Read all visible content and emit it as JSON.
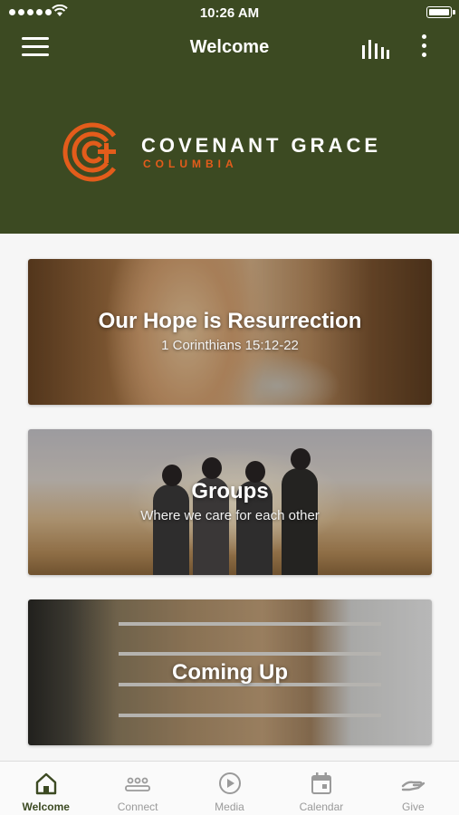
{
  "status_bar": {
    "time": "10:26 AM"
  },
  "nav": {
    "title": "Welcome"
  },
  "logo": {
    "name": "COVENANT GRACE",
    "sub": "COLUMBIA"
  },
  "cards": [
    {
      "title": "Our Hope is Resurrection",
      "subtitle": "1 Corinthians 15:12-22"
    },
    {
      "title": "Groups",
      "subtitle": "Where we care for each other"
    },
    {
      "title": "Coming Up",
      "subtitle": ""
    }
  ],
  "tabs": [
    {
      "label": "Welcome",
      "icon": "home-icon",
      "active": true
    },
    {
      "label": "Connect",
      "icon": "people-icon",
      "active": false
    },
    {
      "label": "Media",
      "icon": "play-icon",
      "active": false
    },
    {
      "label": "Calendar",
      "icon": "calendar-icon",
      "active": false
    },
    {
      "label": "Give",
      "icon": "give-icon",
      "active": false
    }
  ],
  "colors": {
    "brand_green": "#3c4a22",
    "brand_orange": "#e35c1b",
    "inactive_gray": "#9a9a9a"
  }
}
